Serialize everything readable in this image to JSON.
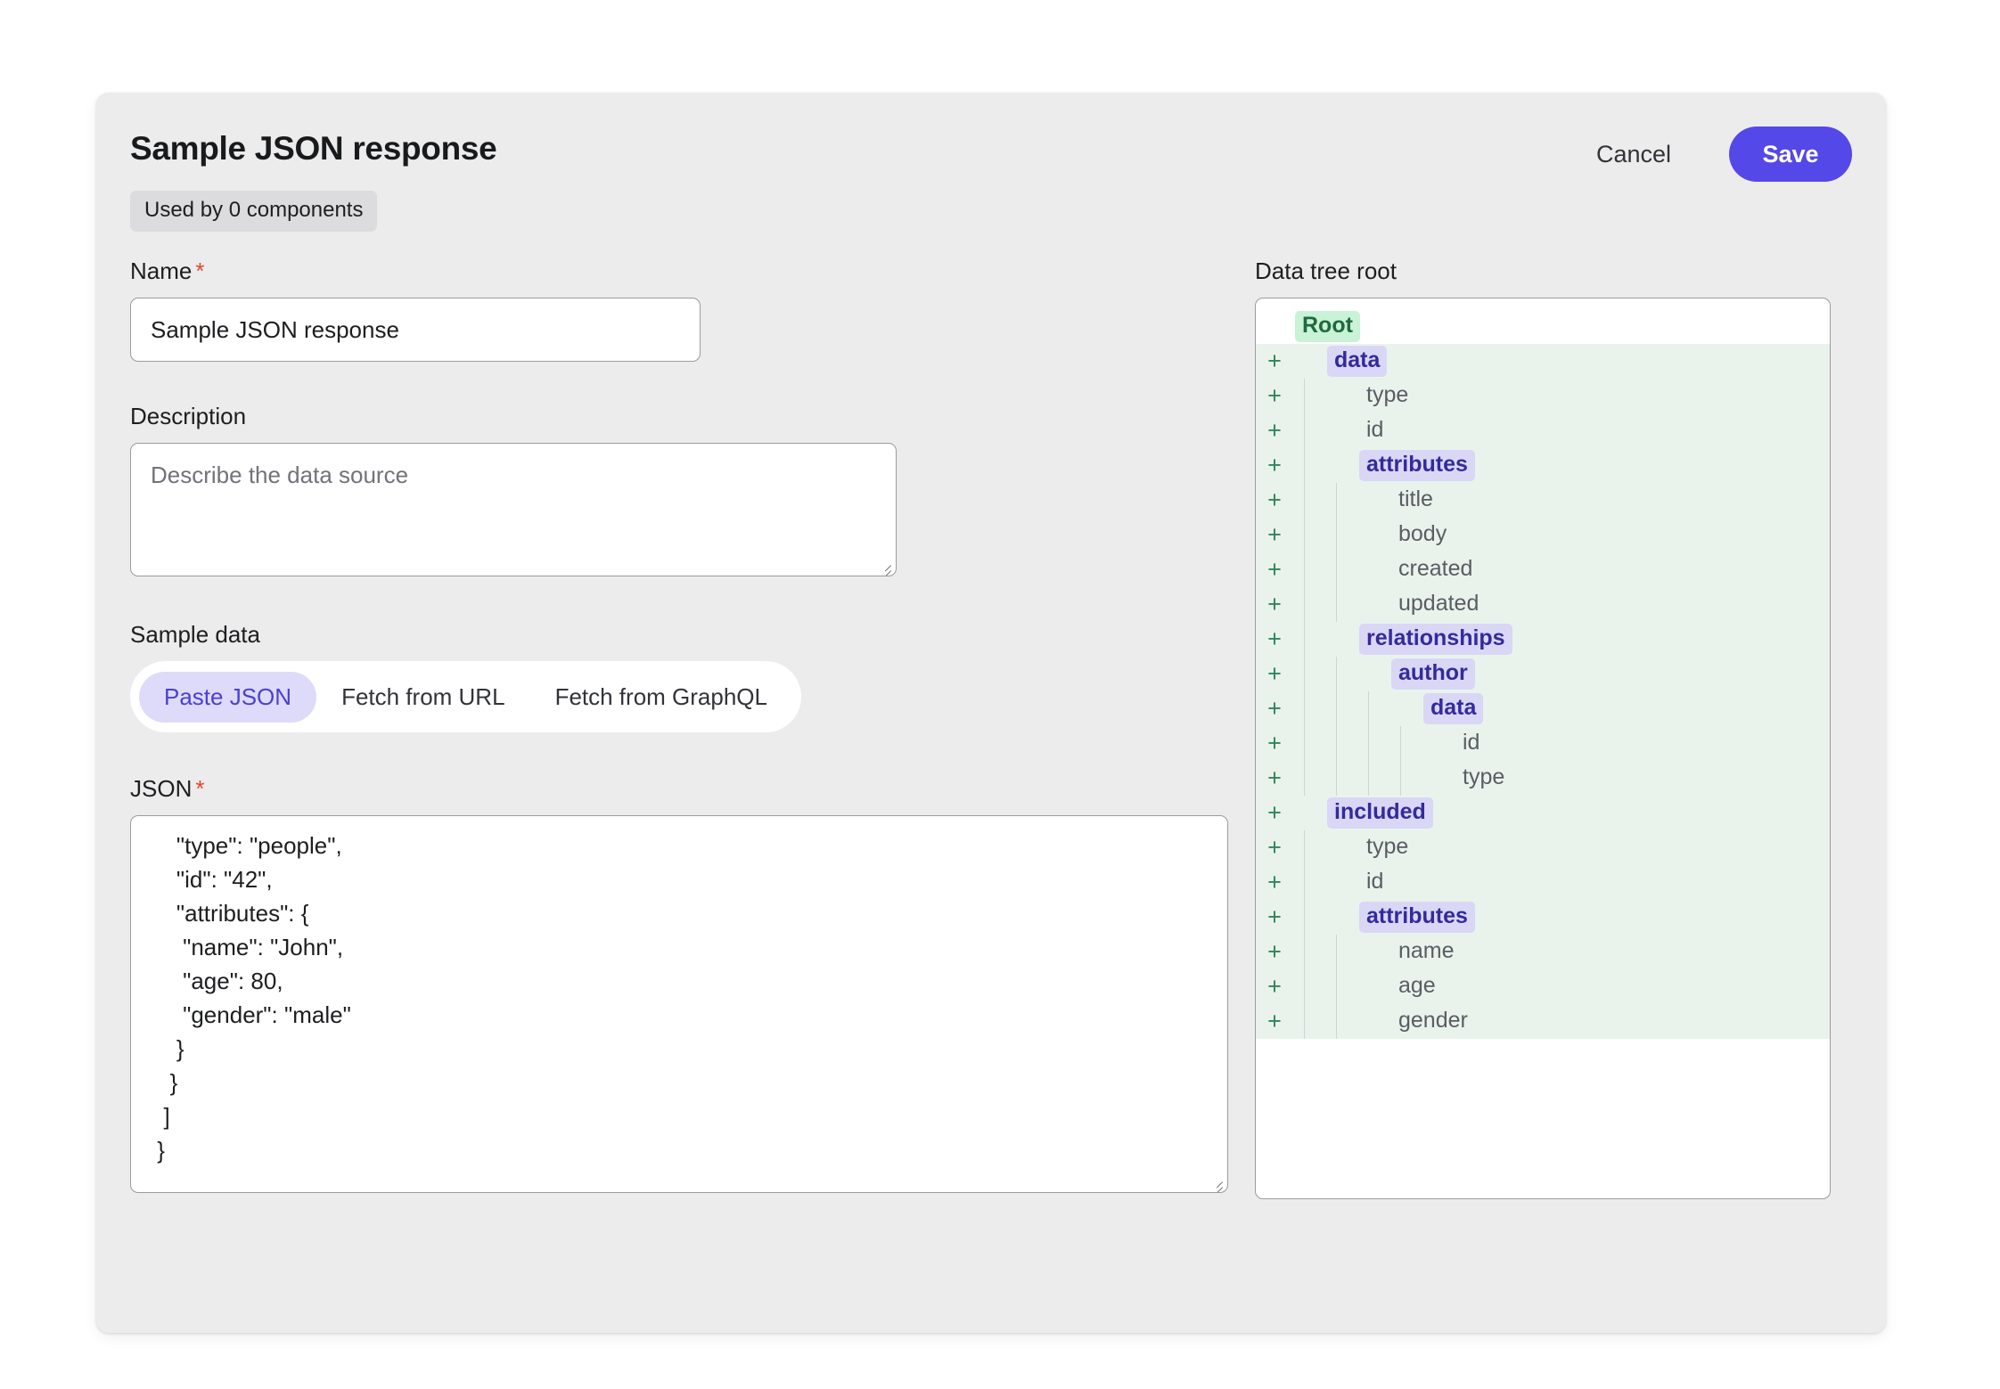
{
  "header": {
    "title": "Sample JSON response",
    "usage_badge": "Used by 0 components",
    "cancel_label": "Cancel",
    "save_label": "Save"
  },
  "form": {
    "name": {
      "label": "Name",
      "required_marker": "*",
      "value": "Sample JSON response"
    },
    "description": {
      "label": "Description",
      "value": "",
      "placeholder": "Describe the data source"
    },
    "sample_data": {
      "label": "Sample data",
      "options": [
        "Paste JSON",
        "Fetch from URL",
        "Fetch from GraphQL"
      ],
      "selected": "Paste JSON"
    },
    "json": {
      "label": "JSON",
      "required_marker": "*",
      "value": "    \"type\": \"people\",\n    \"id\": \"42\",\n    \"attributes\": {\n     \"name\": \"John\",\n     \"age\": 80,\n     \"gender\": \"male\"\n    }\n   }\n  ]\n }"
    }
  },
  "tree": {
    "title": "Data tree root",
    "expand_icon": "+",
    "nodes": [
      {
        "label": "Root",
        "depth": 0,
        "kind": "root",
        "expander": false
      },
      {
        "label": "data",
        "depth": 1,
        "kind": "obj",
        "expander": true
      },
      {
        "label": "type",
        "depth": 2,
        "kind": "leaf",
        "expander": true
      },
      {
        "label": "id",
        "depth": 2,
        "kind": "leaf",
        "expander": true
      },
      {
        "label": "attributes",
        "depth": 2,
        "kind": "obj",
        "expander": true
      },
      {
        "label": "title",
        "depth": 3,
        "kind": "leaf",
        "expander": true
      },
      {
        "label": "body",
        "depth": 3,
        "kind": "leaf",
        "expander": true
      },
      {
        "label": "created",
        "depth": 3,
        "kind": "leaf",
        "expander": true
      },
      {
        "label": "updated",
        "depth": 3,
        "kind": "leaf",
        "expander": true
      },
      {
        "label": "relationships",
        "depth": 2,
        "kind": "obj",
        "expander": true
      },
      {
        "label": "author",
        "depth": 3,
        "kind": "obj",
        "expander": true
      },
      {
        "label": "data",
        "depth": 4,
        "kind": "obj",
        "expander": true
      },
      {
        "label": "id",
        "depth": 5,
        "kind": "leaf",
        "expander": true
      },
      {
        "label": "type",
        "depth": 5,
        "kind": "leaf",
        "expander": true
      },
      {
        "label": "included",
        "depth": 1,
        "kind": "obj",
        "expander": true
      },
      {
        "label": "type",
        "depth": 2,
        "kind": "leaf",
        "expander": true
      },
      {
        "label": "id",
        "depth": 2,
        "kind": "leaf",
        "expander": true
      },
      {
        "label": "attributes",
        "depth": 2,
        "kind": "obj",
        "expander": true
      },
      {
        "label": "name",
        "depth": 3,
        "kind": "leaf",
        "expander": true
      },
      {
        "label": "age",
        "depth": 3,
        "kind": "leaf",
        "expander": true
      },
      {
        "label": "gender",
        "depth": 3,
        "kind": "leaf",
        "expander": true
      }
    ]
  },
  "colors": {
    "accent": "#5548e8",
    "accent_soft_bg": "#dedbfa",
    "accent_soft_text": "#4a3fd6",
    "object_node_bg": "#d9d7f5",
    "object_node_text": "#342a9e",
    "root_node_bg": "#c9f2d6",
    "root_node_text": "#1d6b3e",
    "tree_band_bg": "#e9f3ec",
    "expander": "#2f8659",
    "required": "#e8432f",
    "card_bg": "#ececed"
  }
}
